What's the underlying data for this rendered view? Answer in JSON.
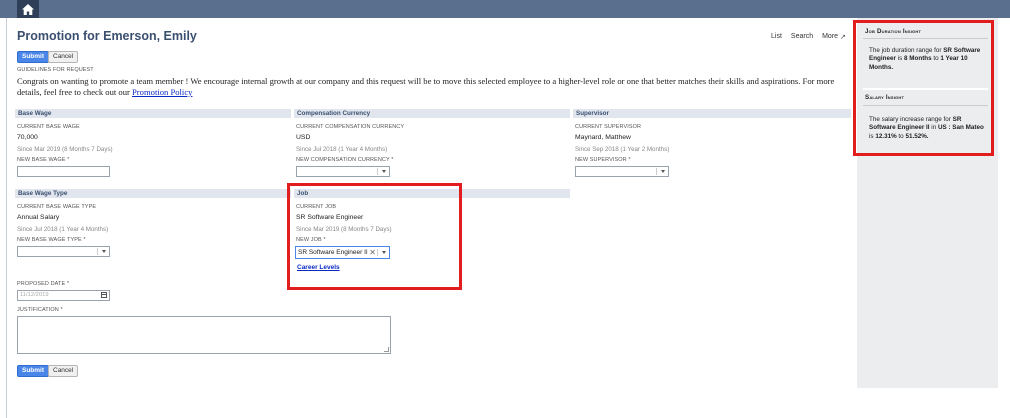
{
  "topbar": {
    "home_icon": "home-icon"
  },
  "page": {
    "title": "Promotion for Emerson, Emily"
  },
  "top_links": [
    "List",
    "Search",
    "More"
  ],
  "buttons": {
    "submit": "Submit",
    "cancel": "Cancel"
  },
  "guidelines": {
    "label": "GUIDELINES FOR REQUEST",
    "text": "Congrats on wanting to promote a team member ! We encourage internal growth at our company and this request will be to move this selected employee to a higher-level role or one that better matches their skills and aspirations. For more details, feel free to check out our",
    "link": "Promotion Policy"
  },
  "base_wage": {
    "header": "Base Wage",
    "current_label": "CURRENT BASE WAGE",
    "current_value": "70,000",
    "since": "Since Mar 2019 (8 Months 7 Days)",
    "new_label": "NEW BASE WAGE *"
  },
  "compensation_currency": {
    "header": "Compensation Currency",
    "current_label": "CURRENT COMPENSATION CURRENCY",
    "current_value": "USD",
    "since": "Since Jul 2018 (1 Year 4 Months)",
    "new_label": "NEW COMPENSATION CURRENCY *"
  },
  "supervisor": {
    "header": "Supervisor",
    "current_label": "CURRENT SUPERVISOR",
    "current_value": "Maynard, Matthew",
    "since": "Since Sep 2018 (1 Year 2 Months)",
    "new_label": "NEW SUPERVISOR *"
  },
  "base_wage_type": {
    "header": "Base Wage Type",
    "current_label": "CURRENT BASE WAGE TYPE",
    "current_value": "Annual Salary",
    "since": "Since Jul 2018 (1 Year 4 Months)",
    "new_label": "NEW BASE WAGE TYPE *"
  },
  "job": {
    "header": "Job",
    "current_label": "CURRENT JOB",
    "current_value": "SR Software Engineer",
    "since": "Since Mar 2019 (8 Months 7 Days)",
    "new_label": "NEW JOB *",
    "new_value": "SR Software Engineer II",
    "career_link": "Career Levels"
  },
  "proposed_date": {
    "label": "PROPOSED DATE *",
    "placeholder": "11/12/2019"
  },
  "justification": {
    "label": "JUSTIFICATION *"
  },
  "insights": {
    "job_duration": {
      "title": "Job Duration Insight",
      "t1": "The job duration range for ",
      "b1": "SR Software Engineer",
      "t2": " is ",
      "b2": "8 Months",
      "t3": " to ",
      "b3": "1 Year 10 Months."
    },
    "salary": {
      "title": "Salary Insight",
      "t1": "The salary increase range for ",
      "b1": "SR Software Engineer II",
      "t2": " in ",
      "b2": "US : San Mateo",
      "t3": " is ",
      "b3": "12.31%",
      "t4": " to ",
      "b4": "51.52%.",
      "t5": ""
    }
  },
  "colors": {
    "accent": "#4a86e8",
    "highlight": "#e21d1d",
    "title": "#3b4f70"
  }
}
